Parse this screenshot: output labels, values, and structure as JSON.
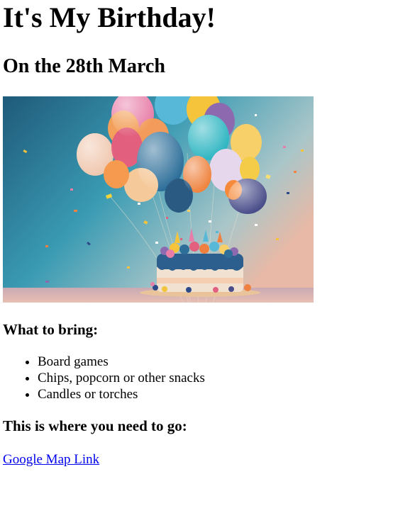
{
  "header": {
    "title": "It's My Birthday!",
    "date": "On the 28th March"
  },
  "hero_image": {
    "subject": "birthday cake with colorful balloons and confetti"
  },
  "bring": {
    "heading": "What to bring:",
    "items": [
      "Board games",
      "Chips, popcorn or other snacks",
      "Candles or torches"
    ]
  },
  "location": {
    "heading": "This is where you need to go:",
    "link_label": "Google Map Link"
  },
  "colors": {
    "link": "#0000ee",
    "text": "#000000",
    "background": "#ffffff"
  }
}
